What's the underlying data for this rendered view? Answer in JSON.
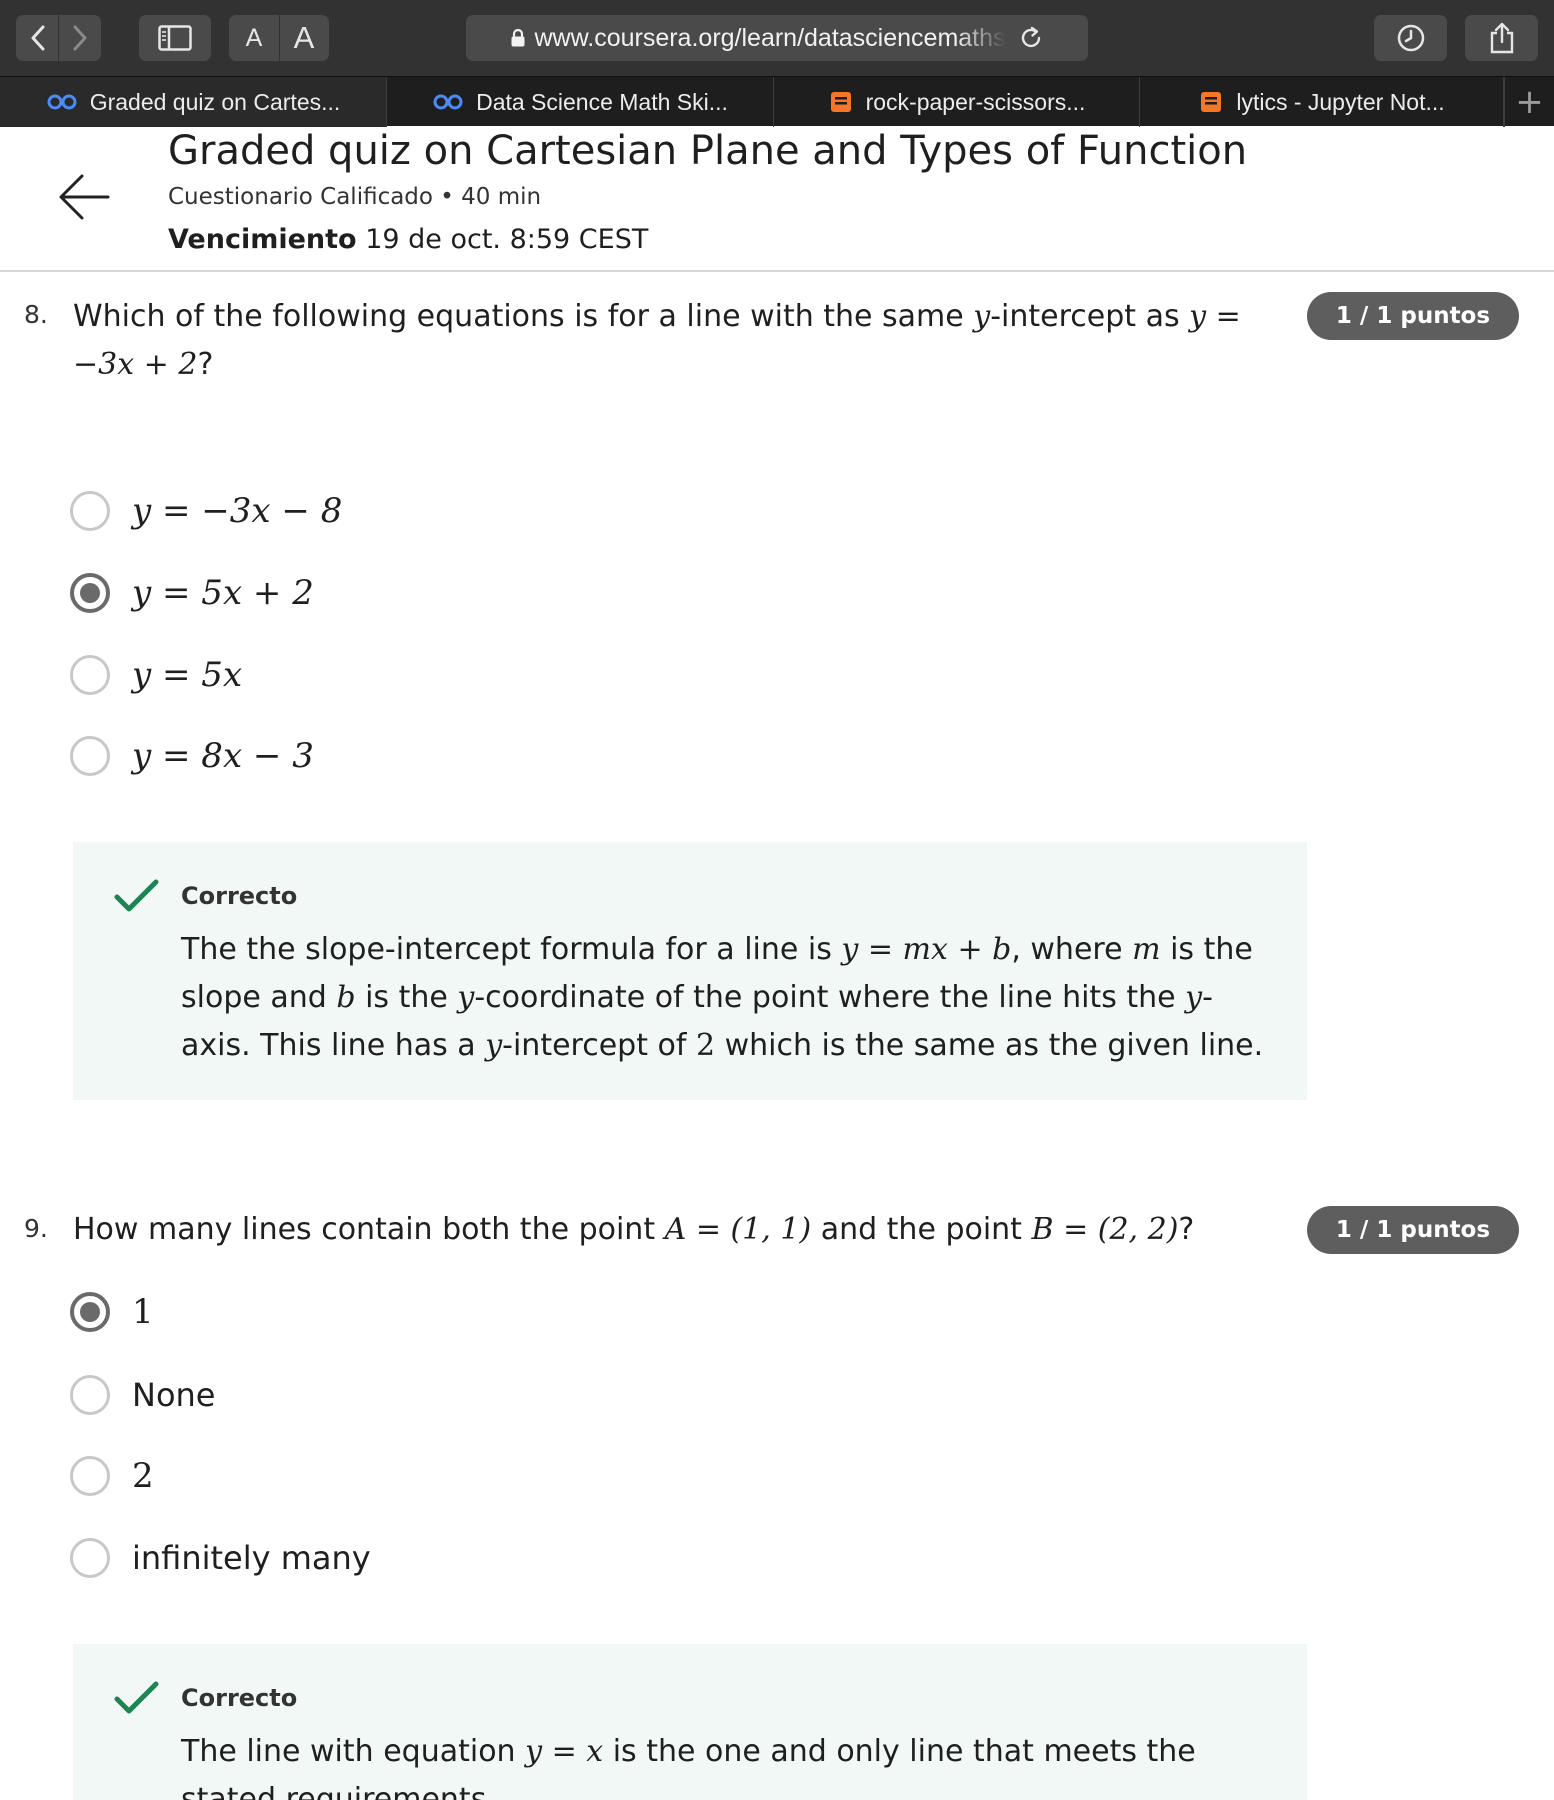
{
  "browser": {
    "text_size_small": "A",
    "text_size_large": "A",
    "url": "www.coursera.org/learn/datasciencemaths",
    "tabs": [
      {
        "label": "Graded quiz on Cartes...",
        "icon": "coursera-icon"
      },
      {
        "label": "Data Science Math Ski...",
        "icon": "coursera-icon"
      },
      {
        "label": "rock-paper-scissors...",
        "icon": "jupyter-notebook-icon"
      },
      {
        "label": "lytics - Jupyter Not...",
        "icon": "jupyter-notebook-icon"
      }
    ],
    "new_tab": "+"
  },
  "header": {
    "title": "Graded quiz on Cartesian Plane and Types of Function",
    "subtitle": "Cuestionario Calificado • 40 min",
    "due_label": "Vencimiento",
    "due_value": "19 de oct. 8:59 CEST"
  },
  "questions": [
    {
      "number": "8.",
      "text_a": "Which of the following equations is for a line with the same ",
      "var_y": "y",
      "text_b": "-intercept as ",
      "math_tail": "y =",
      "math_line2": "−3x + 2",
      "text_end": "?",
      "points": "1 / 1 puntos",
      "options": [
        {
          "label": "y = −3x − 8",
          "selected": false
        },
        {
          "label": "y = 5x + 2",
          "selected": true
        },
        {
          "label": "y = 5x",
          "selected": false
        },
        {
          "label": "y = 8x − 3",
          "selected": false
        }
      ],
      "feedback": {
        "title": "Correcto",
        "p1": "The the slope-intercept formula for a line is ",
        "m1": "y = mx + b",
        "p2": ", where ",
        "m2": "m",
        "p3": " is the slope and ",
        "m3": "b",
        "p4": " is the ",
        "m4": "y",
        "p5": "-coordinate of the point where the line hits the ",
        "m5": "y",
        "p6": "-axis. This line has a ",
        "m6": "y",
        "p7": "-intercept of ",
        "m7": "2",
        "p8": " which is the same as the given line."
      }
    },
    {
      "number": "9.",
      "text_a": "How many lines contain both the point ",
      "m_a": "A = (1, 1)",
      "text_b": " and the point ",
      "m_b": "B = (2, 2)",
      "text_end": "?",
      "points": "1 / 1 puntos",
      "options": [
        {
          "label": "1",
          "selected": true
        },
        {
          "label": "None",
          "selected": false
        },
        {
          "label": "2",
          "selected": false
        },
        {
          "label": "infinitely many",
          "selected": false
        }
      ],
      "feedback": {
        "title": "Correcto",
        "p1": "The line with equation ",
        "m1": "y = x",
        "p2": " is the one and only line that meets the stated requirements."
      }
    }
  ],
  "colors": {
    "toolbar_bg": "#323232",
    "tab_bg": "#1e1e1e",
    "points_badge": "#5e5e5e",
    "feedback_bg": "#f2f8f6",
    "check_green": "#1f8354",
    "coursera_blue": "#4a8bf5",
    "jupyter_orange": "#f37726"
  }
}
